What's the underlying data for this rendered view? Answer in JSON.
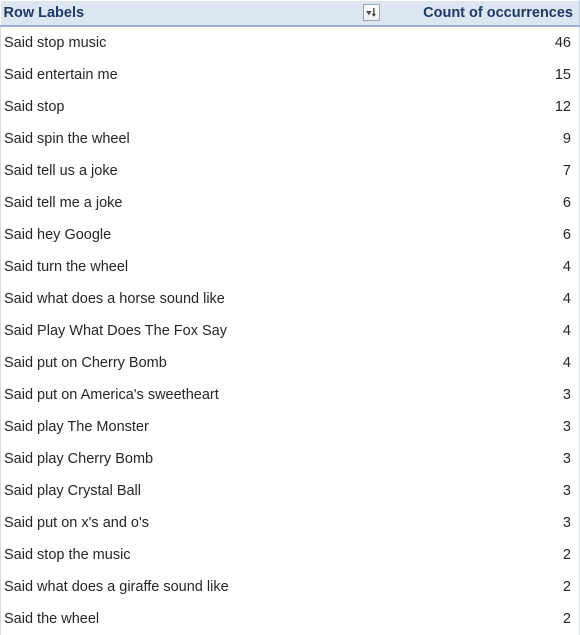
{
  "table": {
    "columns": [
      {
        "key": "row_labels",
        "label": "Row Labels",
        "align": "left"
      },
      {
        "key": "count",
        "label": "Count of occurrences",
        "align": "right"
      }
    ],
    "header": {
      "row_labels_label": "Row Labels",
      "count_label": "Count of occurrences",
      "filter_icon": "sort-descending-filter-icon",
      "filter_state": "sorted-descending"
    },
    "rows": [
      {
        "label": "Said stop music",
        "count": 46
      },
      {
        "label": "Said entertain me",
        "count": 15
      },
      {
        "label": "Said stop",
        "count": 12
      },
      {
        "label": "Said spin the wheel",
        "count": 9
      },
      {
        "label": "Said tell us a joke",
        "count": 7
      },
      {
        "label": "Said tell me a joke",
        "count": 6
      },
      {
        "label": "Said hey Google",
        "count": 6
      },
      {
        "label": "Said turn the wheel",
        "count": 4
      },
      {
        "label": "Said what does a horse sound like",
        "count": 4
      },
      {
        "label": "Said Play What Does The Fox Say",
        "count": 4
      },
      {
        "label": "Said put on Cherry Bomb",
        "count": 4
      },
      {
        "label": "Said put on America's sweetheart",
        "count": 3
      },
      {
        "label": "Said play The Monster",
        "count": 3
      },
      {
        "label": "Said play Cherry Bomb",
        "count": 3
      },
      {
        "label": "Said play Crystal Ball",
        "count": 3
      },
      {
        "label": "Said put on x's and o's",
        "count": 3
      },
      {
        "label": "Said stop the music",
        "count": 2
      },
      {
        "label": "Said what does a giraffe sound like",
        "count": 2
      },
      {
        "label": "Said the wheel",
        "count": 2
      }
    ]
  },
  "colors": {
    "header_background": "#dce6f1",
    "header_text": "#1f3864",
    "header_rule": "#95b3d7",
    "body_text": "#262626",
    "grid_line": "#d4dce6",
    "page_background": "#ffffff"
  },
  "chart_data": {
    "type": "table",
    "title": "Count of occurrences",
    "columns": [
      "Row Labels",
      "Count of occurrences"
    ],
    "categories": [
      "Said stop music",
      "Said entertain me",
      "Said stop",
      "Said spin the wheel",
      "Said tell us a joke",
      "Said tell me a joke",
      "Said hey Google",
      "Said turn the wheel",
      "Said what does a horse sound like",
      "Said Play What Does The Fox Say",
      "Said put on Cherry Bomb",
      "Said put on America's sweetheart",
      "Said play The Monster",
      "Said play Cherry Bomb",
      "Said play Crystal Ball",
      "Said put on x's and o's",
      "Said stop the music",
      "Said what does a giraffe sound like",
      "Said the wheel"
    ],
    "values": [
      46,
      15,
      12,
      9,
      7,
      6,
      6,
      4,
      4,
      4,
      4,
      3,
      3,
      3,
      3,
      3,
      2,
      2,
      2
    ],
    "xlabel": "Row Labels",
    "ylabel": "Count of occurrences",
    "sort": "descending by Count of occurrences"
  }
}
